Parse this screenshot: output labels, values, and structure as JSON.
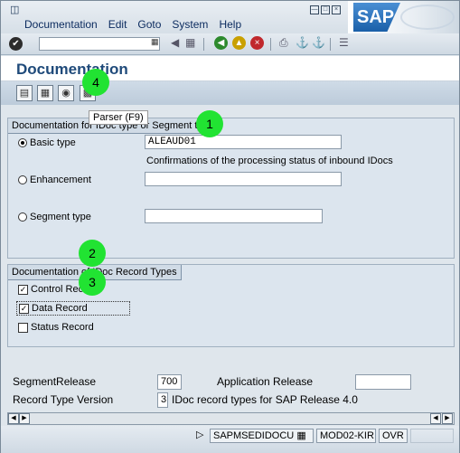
{
  "menu": {
    "items": [
      "Documentation",
      "Edit",
      "Goto",
      "System",
      "Help"
    ]
  },
  "logo": {
    "text": "SAP"
  },
  "standard_toolbar": {
    "command_value": "",
    "icons": [
      "check-icon",
      "back-icon",
      "exit-icon",
      "cancel-icon",
      "print-icon",
      "find-icon",
      "find-next-icon",
      "layout-icon"
    ]
  },
  "title": "Documentation",
  "app_toolbar": {
    "tooltip": "Parser   (F9)"
  },
  "frame1": {
    "title": "Documentation for IDoc type or Segment type",
    "basic_type_label": "Basic type",
    "basic_type_value": "ALEAUD01",
    "basic_type_desc": "Confirmations of the processing status of inbound IDocs",
    "enhancement_label": "Enhancement",
    "enhancement_value": "",
    "segment_type_label": "Segment type",
    "segment_type_value": ""
  },
  "frame2": {
    "title": "Documentation of IDoc Record Types",
    "control_record": "Control Record",
    "data_record": "Data Record",
    "status_record": "Status Record"
  },
  "markers": [
    "1",
    "2",
    "3",
    "4"
  ],
  "bottom": {
    "segment_release_label": "SegmentRelease",
    "segment_release_value": "700",
    "app_release_label": "Application Release",
    "app_release_value": "",
    "record_type_label": "Record Type Version",
    "record_type_value": "3",
    "record_type_desc": "IDoc record types for SAP Release 4.0"
  },
  "status": {
    "program": "SAPMSEDIDOCU",
    "server": "MOD02-KIR",
    "mode": "OVR"
  },
  "colors": {
    "title": "#1f4a7a",
    "marker": "#21e332",
    "frame_bg": "#dce5ee"
  }
}
